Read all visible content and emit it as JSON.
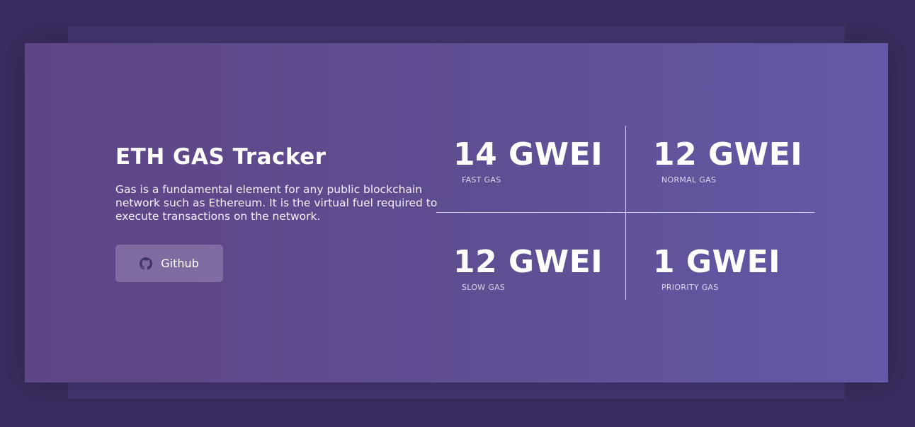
{
  "header": {
    "title": "ETH GAS Tracker",
    "description": "Gas is a fundamental element for any public blockchain network such as Ethereum. It is the virtual fuel required to execute transactions on the network."
  },
  "github_button": {
    "label": "Github",
    "icon": "github-icon"
  },
  "stats": [
    {
      "value": "14 GWEI",
      "label": "FAST GAS"
    },
    {
      "value": "12 GWEI",
      "label": "NORMAL GAS"
    },
    {
      "value": "12 GWEI",
      "label": "SLOW GAS"
    },
    {
      "value": "1 GWEI",
      "label": "PRIORITY GAS"
    }
  ],
  "colors": {
    "background": "#3a2d5e",
    "back_panel": "#443670",
    "card_gradient_start": "#5e4586",
    "card_gradient_end": "#6459a6",
    "text": "#ffffff"
  }
}
